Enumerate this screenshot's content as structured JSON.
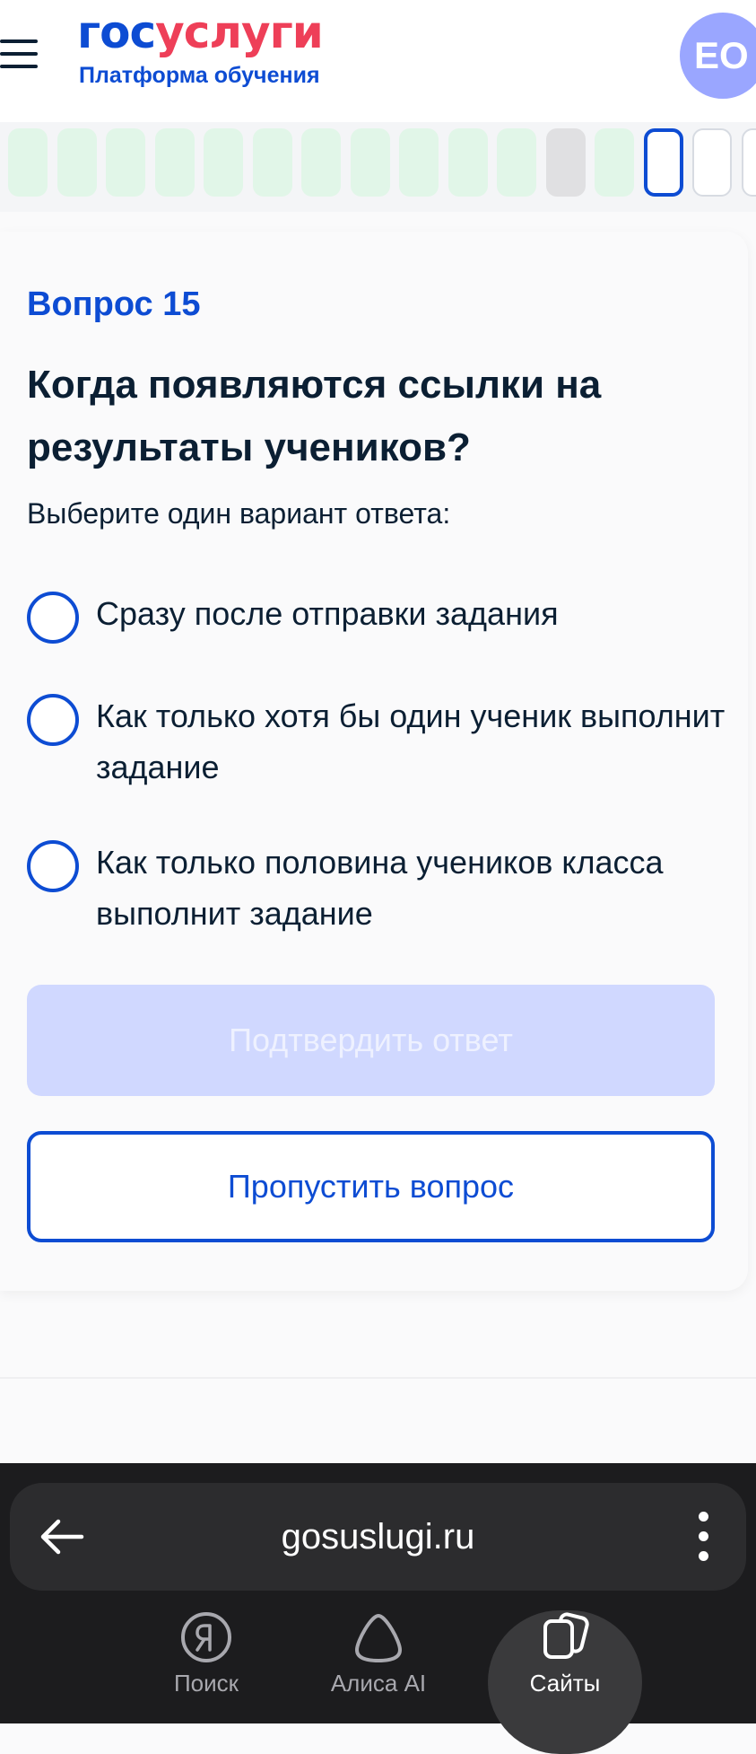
{
  "header": {
    "logo_part1": "гос",
    "logo_part2": "услуги",
    "logo_subtitle": "Платформа обучения",
    "avatar_initials": "ЕО"
  },
  "progress": {
    "cells": [
      "done",
      "done",
      "done",
      "done",
      "done",
      "done",
      "done",
      "done",
      "done",
      "done",
      "done",
      "skipped",
      "done",
      "current",
      "todo",
      "todo"
    ]
  },
  "question": {
    "number_label": "Вопрос 15",
    "title": "Когда появляются ссылки на результаты учеников?",
    "hint": "Выберите один вариант ответа:",
    "options": [
      {
        "label": "Сразу после отправки задания"
      },
      {
        "label": "Как только хотя бы один ученик выполнит задание"
      },
      {
        "label": "Как только половина учеников класса выполнит задание"
      }
    ],
    "confirm_label": "Подтвердить ответ",
    "skip_label": "Пропустить вопрос"
  },
  "browser": {
    "url": "gosuslugi.ru",
    "tabs": [
      {
        "label": "Поиск",
        "icon": "yandex-search-icon"
      },
      {
        "label": "Алиса AI",
        "icon": "alice-icon"
      },
      {
        "label": "Сайты",
        "icon": "sites-icon"
      }
    ]
  },
  "colors": {
    "accent": "#0d4cd3",
    "logo_red": "#ee3f58",
    "answered": "#e1f6e8",
    "skipped": "#e0e0e2",
    "confirm_disabled": "#d0d8ff",
    "avatar": "#9aa6ff"
  }
}
